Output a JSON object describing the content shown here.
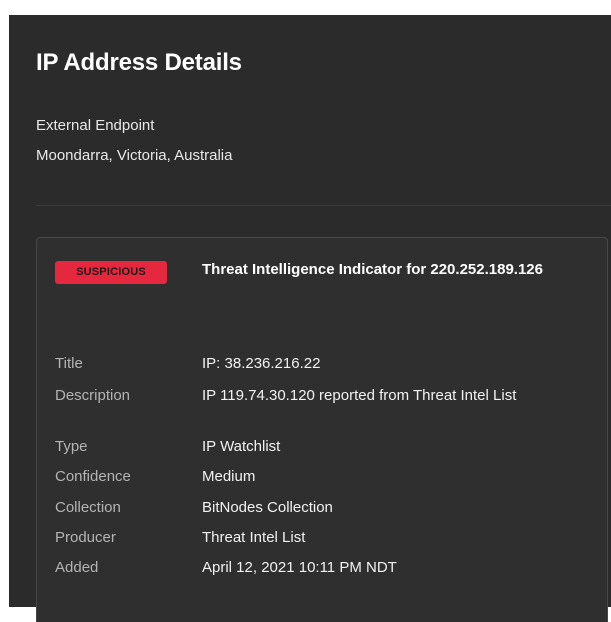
{
  "header": {
    "title": "IP Address Details",
    "endpoint_type": "External Endpoint",
    "location": "Moondarra, Victoria, Australia"
  },
  "indicator": {
    "badge": "SUSPICIOUS",
    "badge_color": "#e5283d",
    "title": "Threat Intelligence Indicator for 220.252.189.126",
    "fields": [
      {
        "label": "Title",
        "value": "IP: 38.236.216.22"
      },
      {
        "label": "Description",
        "value": "IP 119.74.30.120 reported from Threat Intel List"
      },
      {
        "label": "Type",
        "value": "IP Watchlist"
      },
      {
        "label": "Confidence",
        "value": "Medium"
      },
      {
        "label": "Collection",
        "value": "BitNodes Collection"
      },
      {
        "label": "Producer",
        "value": "Threat Intel List"
      },
      {
        "label": "Added",
        "value": "April 12, 2021 10:11 PM NDT"
      }
    ]
  }
}
